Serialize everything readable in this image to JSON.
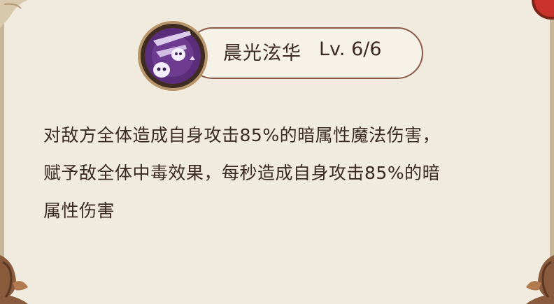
{
  "skill": {
    "name": "晨光泫华",
    "level": "Lv.  6/6",
    "icon": "dark-skulls-icon",
    "description_lines": [
      "对敌方全体造成自身攻击85%的暗属性魔法伤害，",
      "赋予敌全体中毒效果，每秒造成自身攻击85%的暗",
      "属性伤害"
    ]
  },
  "colors": {
    "panel_background": "#f1ebdf",
    "pill_border": "#8b5a49",
    "text": "#3a2a22",
    "icon_purple": "#6d3b8f"
  }
}
